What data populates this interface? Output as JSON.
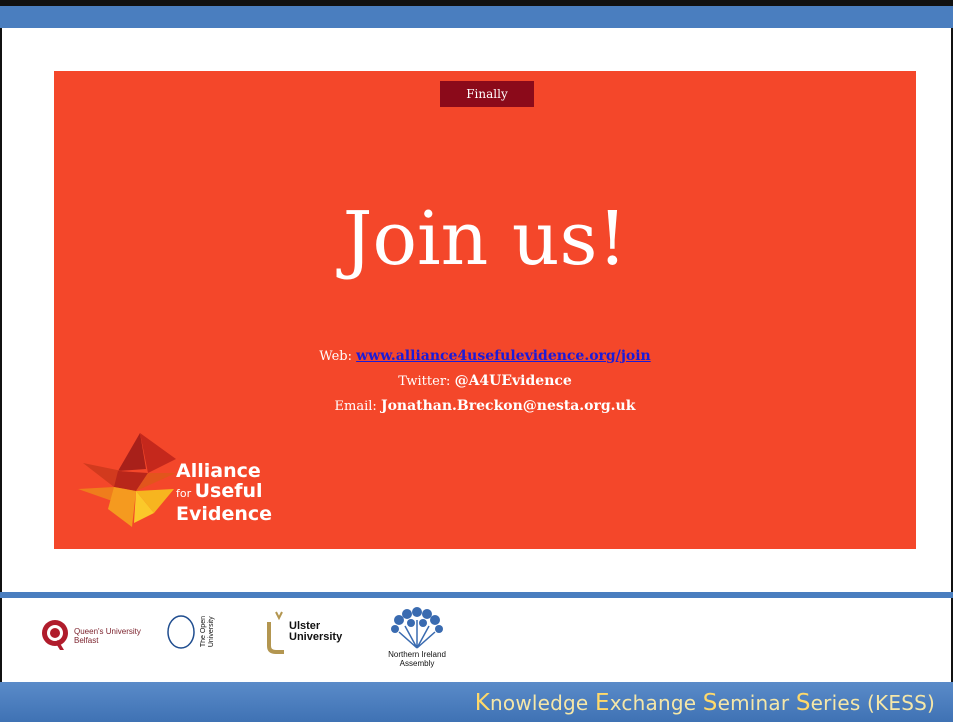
{
  "slide": {
    "section_badge": "Finally",
    "headline": "Join us!",
    "web_label": "Web: ",
    "web_link": "www.alliance4usefulevidence.org/join",
    "twitter_label": "Twitter: ",
    "twitter_handle": "@A4UEvidence",
    "email_label": "Email: ",
    "email_value": "Jonathan.Breckon@nesta.org.uk",
    "brand": {
      "line1": "Alliance",
      "line2_small": "for ",
      "line2": "Useful",
      "line3": "Evidence"
    }
  },
  "partners": {
    "qub_line1": "Queen's University",
    "qub_line2": "Belfast",
    "ou_line1": "The Open",
    "ou_line2": "University",
    "ulster_line1": "Ulster",
    "ulster_line2": "University",
    "nia_line1": "Northern Ireland",
    "nia_line2": "Assembly"
  },
  "footer": {
    "k": "K",
    "k_rest": "nowledge ",
    "e": "E",
    "e_rest": "xchange ",
    "s1": "S",
    "s1_rest": "eminar ",
    "s2": "S",
    "s2_rest": "eries (KESS)"
  },
  "colors": {
    "slide_bg": "#f4472a",
    "badge_bg": "#8b0a1a",
    "accent_blue": "#4a7ebf"
  }
}
